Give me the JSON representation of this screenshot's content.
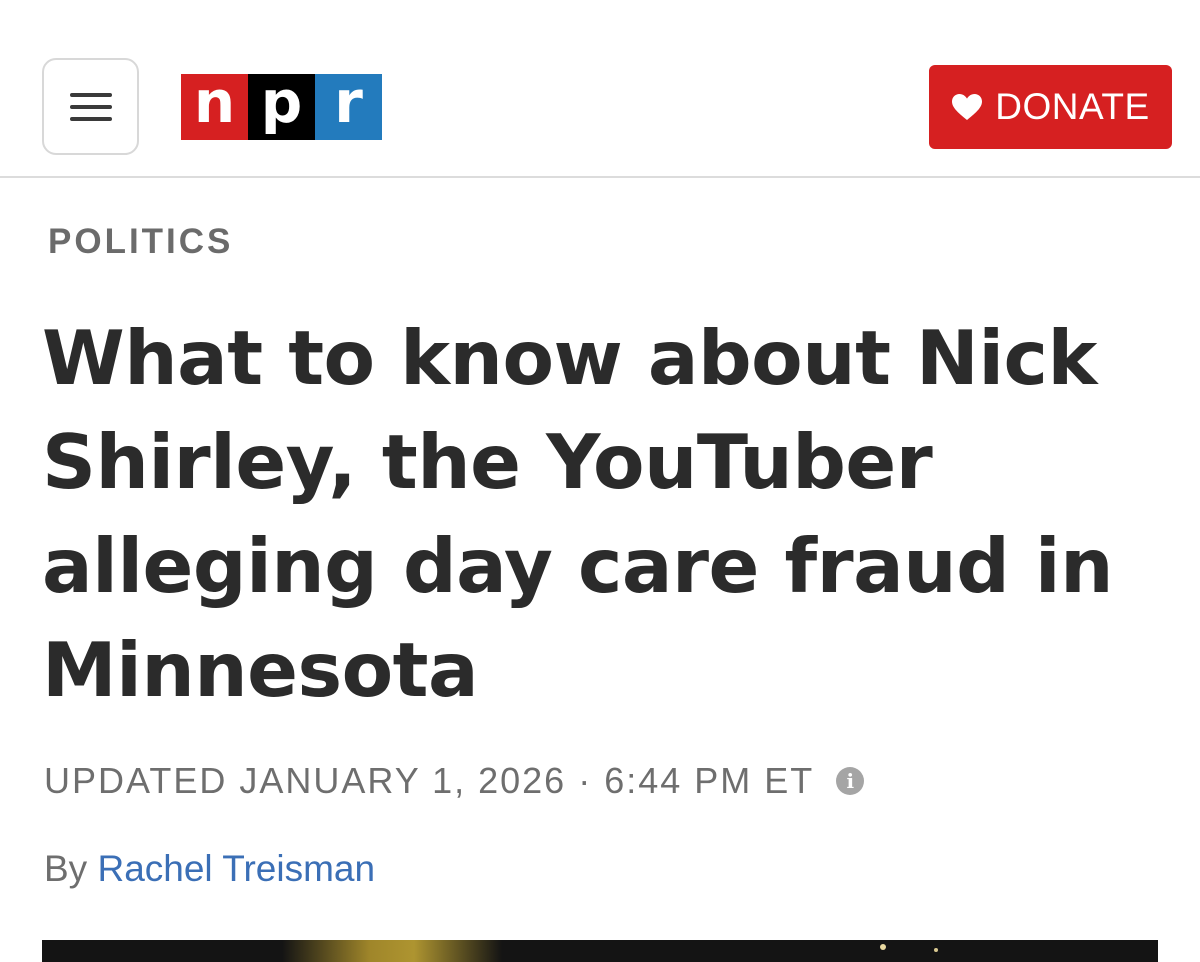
{
  "header": {
    "logo": {
      "letters": [
        "n",
        "p",
        "r"
      ]
    },
    "donate_label": "DONATE",
    "colors": {
      "brand_red": "#d62021",
      "brand_black": "#000000",
      "brand_blue": "#237bbd"
    }
  },
  "article": {
    "section": "POLITICS",
    "headline": "What to know about Nick Shirley, the YouTuber alleging day care fraud in Minnesota",
    "updated_label": "UPDATED JANUARY 1, 2026",
    "separator": "·",
    "time": "6:44 PM ET",
    "info_glyph": "i",
    "byline_prefix": "By",
    "author": "Rachel Treisman"
  },
  "icons": {
    "menu": "hamburger-menu-icon",
    "donate": "heart-icon",
    "info": "info-icon"
  }
}
